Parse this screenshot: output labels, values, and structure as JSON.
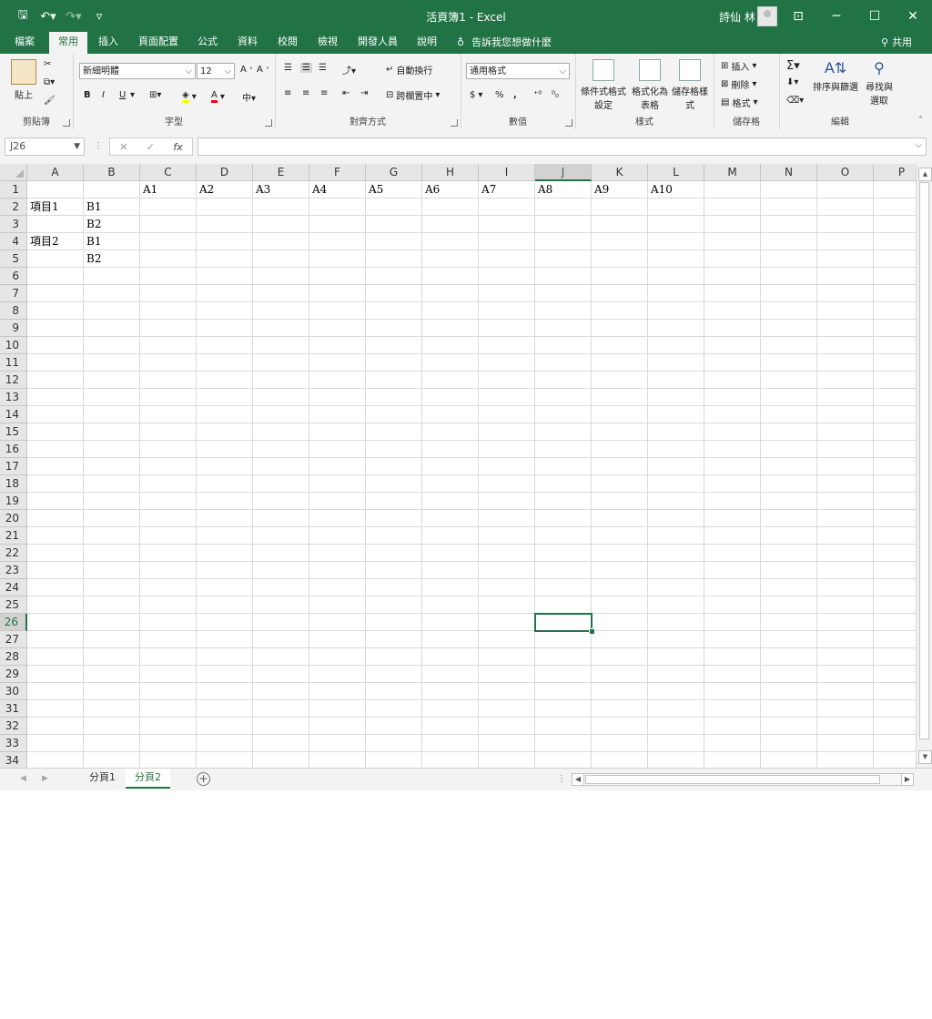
{
  "window": {
    "title": "活頁簿1 - Excel",
    "user": "詩仙 林",
    "controls": [
      "⊡",
      "─",
      "☐",
      "✕"
    ]
  },
  "qat": {
    "save": "🖫",
    "undo": "↶▾",
    "redo": "↷▾",
    "customize": "▿"
  },
  "ribbon": {
    "tabs": [
      "檔案",
      "常用",
      "插入",
      "頁面配置",
      "公式",
      "資料",
      "校閱",
      "檢視",
      "開發人員",
      "說明"
    ],
    "active_tab": "常用",
    "tell_me": "告訴我您想做什麼",
    "share": "共用",
    "groups": {
      "clipboard": {
        "label": "剪貼簿",
        "paste": "貼上"
      },
      "font": {
        "label": "字型",
        "font_name": "新細明體",
        "font_size": "12",
        "bold": "B",
        "italic": "I",
        "underline": "U"
      },
      "alignment": {
        "label": "對齊方式",
        "wrap_text": "自動換行",
        "merge_center": "跨欄置中"
      },
      "number": {
        "label": "數值",
        "format": "通用格式",
        "currency": "$",
        "percent": "%",
        "comma": ","
      },
      "styles": {
        "label": "樣式",
        "conditional": "條件式格式設定",
        "format_table": "格式化為表格",
        "cell_styles": "儲存格樣式"
      },
      "cells": {
        "label": "儲存格",
        "insert": "插入",
        "delete": "刪除",
        "format": "格式"
      },
      "editing": {
        "label": "編輯",
        "sort_filter": "排序與篩選",
        "find_select": "尋找與選取"
      }
    }
  },
  "formula_bar": {
    "name_box": "J26",
    "formula": "",
    "fx": "fx"
  },
  "sheet": {
    "columns": [
      "A",
      "B",
      "C",
      "D",
      "E",
      "F",
      "G",
      "H",
      "I",
      "J",
      "K",
      "L",
      "M",
      "N",
      "O",
      "P"
    ],
    "rows": [
      "1",
      "2",
      "3",
      "4",
      "5",
      "6",
      "7",
      "8",
      "9",
      "10",
      "11",
      "12",
      "13",
      "14",
      "15",
      "16",
      "17",
      "18",
      "19",
      "20",
      "21",
      "22",
      "23",
      "24",
      "25",
      "26",
      "27",
      "28",
      "29",
      "30",
      "31",
      "32",
      "33",
      "34"
    ],
    "selected_cell": "J26",
    "cells": {
      "C1": "A1",
      "D1": "A2",
      "E1": "A3",
      "F1": "A4",
      "G1": "A5",
      "H1": "A6",
      "I1": "A7",
      "J1": "A8",
      "K1": "A9",
      "L1": "A10",
      "A2": "項目1",
      "B2": "B1",
      "B3": "B2",
      "A4": "項目2",
      "B4": "B1",
      "B5": "B2"
    }
  },
  "sheet_tabs": {
    "tabs": [
      "分頁1",
      "分頁2"
    ],
    "active": "分頁2"
  },
  "colors": {
    "accent": "#217346",
    "grid": "#dadada",
    "header_bg": "#e6e6e6"
  }
}
